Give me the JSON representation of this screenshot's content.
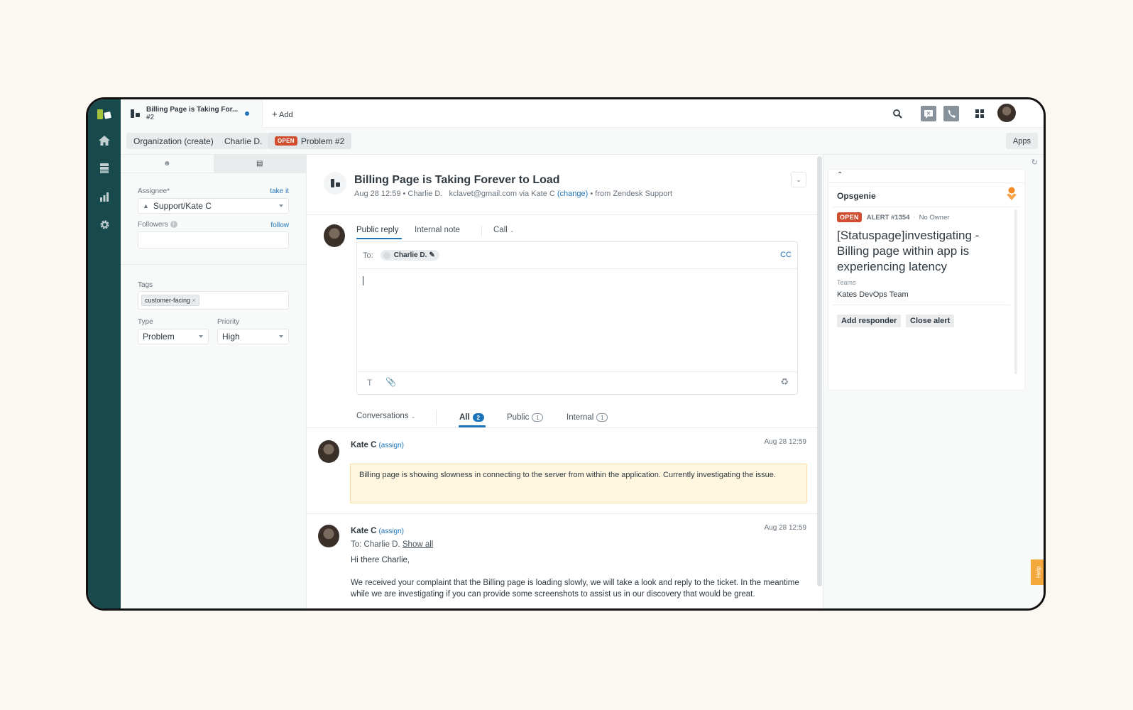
{
  "app": {
    "active_ticket_tab": {
      "title": "Billing Page is Taking For...",
      "number": "#2"
    },
    "add_label": "Add",
    "apps_label": "Apps"
  },
  "nav": {
    "items": [
      {
        "name": "home"
      },
      {
        "name": "views"
      },
      {
        "name": "reporting"
      },
      {
        "name": "admin"
      }
    ]
  },
  "breadcrumbs": [
    {
      "label": "Organization (create)"
    },
    {
      "label": "Charlie D."
    },
    {
      "label": "Problem #2",
      "badge": "OPEN"
    }
  ],
  "properties": {
    "assignee_label": "Assignee*",
    "take_it": "take it",
    "assignee_value": "Support/Kate C",
    "followers_label": "Followers",
    "follow": "follow",
    "followers_value": "",
    "tags_label": "Tags",
    "tags": [
      "customer-facing"
    ],
    "type_label": "Type",
    "type_value": "Problem",
    "priority_label": "Priority",
    "priority_value": "High"
  },
  "ticket": {
    "title": "Billing Page is Taking Forever to Load",
    "meta_prefix": "Aug 28 12:59 • Charlie D.   kclavet@gmail.com via Kate C",
    "change": "(change)",
    "meta_suffix": "• from Zendesk Support"
  },
  "reply": {
    "tabs": [
      "Public reply",
      "Internal note",
      "Call"
    ],
    "active_tab": "Public reply",
    "to_label": "To:",
    "to_recipient": "Charlie D.",
    "cc_label": "CC",
    "body": ""
  },
  "conversations": {
    "filter_label": "Conversations",
    "tabs": [
      {
        "label": "All",
        "count": "2"
      },
      {
        "label": "Public",
        "count": "1"
      },
      {
        "label": "Internal",
        "count": "1"
      }
    ],
    "active_tab": "All",
    "messages": [
      {
        "author": "Kate C",
        "assign": "(assign)",
        "time": "Aug 28 12:59",
        "type": "internal",
        "body": "Billing page is showing slowness in connecting to the server from within the application. Currently investigating the issue."
      },
      {
        "author": "Kate C",
        "assign": "(assign)",
        "time": "Aug 28 12:59",
        "type": "public",
        "to_line": "To: Charlie D.",
        "show_all": "Show all",
        "greeting": "Hi there Charlie,",
        "body": "We received your complaint that the Billing page is loading slowly, we will take a look and reply to the ticket. In the meantime while we are investigating if you can provide some screenshots to assist us in our discovery that would be great."
      }
    ]
  },
  "opsgenie": {
    "title": "Opsgenie",
    "status": "OPEN",
    "alert_id": "ALERT #1354",
    "owner": "No Owner",
    "alert_title": "[Statuspage]investigating - Billing page within app is experiencing latency",
    "teams_label": "Teams",
    "teams_value": "Kates DevOps Team",
    "actions": [
      "Add responder",
      "Close alert"
    ]
  },
  "help_label": "Help",
  "colors": {
    "nav_bg": "#17494d",
    "accent": "#1f73b7",
    "open_badge": "#d04e2f",
    "note_bg": "#fff6e0",
    "help_tab": "#f3a83b"
  }
}
